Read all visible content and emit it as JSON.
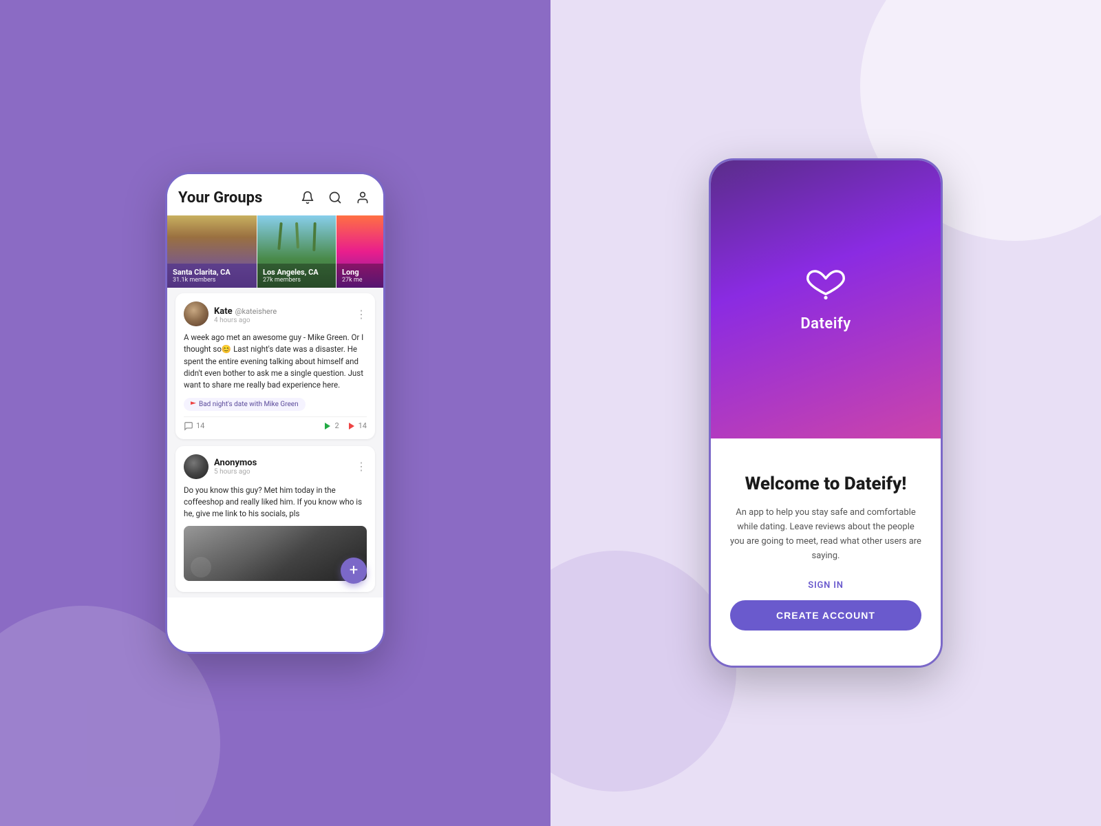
{
  "left_panel": {
    "background_color": "#8b6bc4"
  },
  "right_panel": {
    "background_color": "#e8dff5"
  },
  "groups_screen": {
    "title": "Your Groups",
    "header_icons": [
      "bell",
      "search",
      "user"
    ],
    "groups": [
      {
        "name": "Santa Clarita, CA",
        "members": "31.1k members",
        "color_start": "#d4a857",
        "color_end": "#5a4a8a"
      },
      {
        "name": "Los Angeles, CA",
        "members": "27k members",
        "color_start": "#87ceeb",
        "color_end": "#3a7a3a"
      },
      {
        "name": "Long",
        "members": "27k me",
        "color_start": "#ff7043",
        "color_end": "#7b1fa2"
      }
    ],
    "posts": [
      {
        "author": "Kate",
        "handle": "@kateishere",
        "time": "4 hours ago",
        "text": "A week ago met an awesome guy - Mike Green. Or I thought so😊 Last night's date was a disaster. He spent the entire evening talking about himself and didn't even bother to ask me a single question. Just want to share me really bad experience here.",
        "tag": "Bad night's date with Mike Green",
        "comments": "14",
        "green_flags": "2",
        "red_flags": "14"
      },
      {
        "author": "Anonymos",
        "handle": "",
        "time": "5 hours ago",
        "text": "Do you know this guy? Met him today in the coffeeshop and really liked him. If you know who is he, give me link to his socials, pls",
        "tag": "",
        "comments": "",
        "green_flags": "",
        "red_flags": "",
        "has_image": true
      }
    ],
    "fab_icon": "+"
  },
  "dateify_screen": {
    "logo_alt": "Dateify logo",
    "app_name": "Dateify",
    "welcome_title": "Welcome to Dateify!",
    "welcome_desc": "An app to help you stay safe and comfortable while dating. Leave reviews about the people you are going to meet, read what other users are saying.",
    "signin_label": "SIGN IN",
    "create_account_label": "CREATE ACCOUNT",
    "header_gradient_start": "#5a2d8a",
    "header_gradient_end": "#cc44aa"
  }
}
